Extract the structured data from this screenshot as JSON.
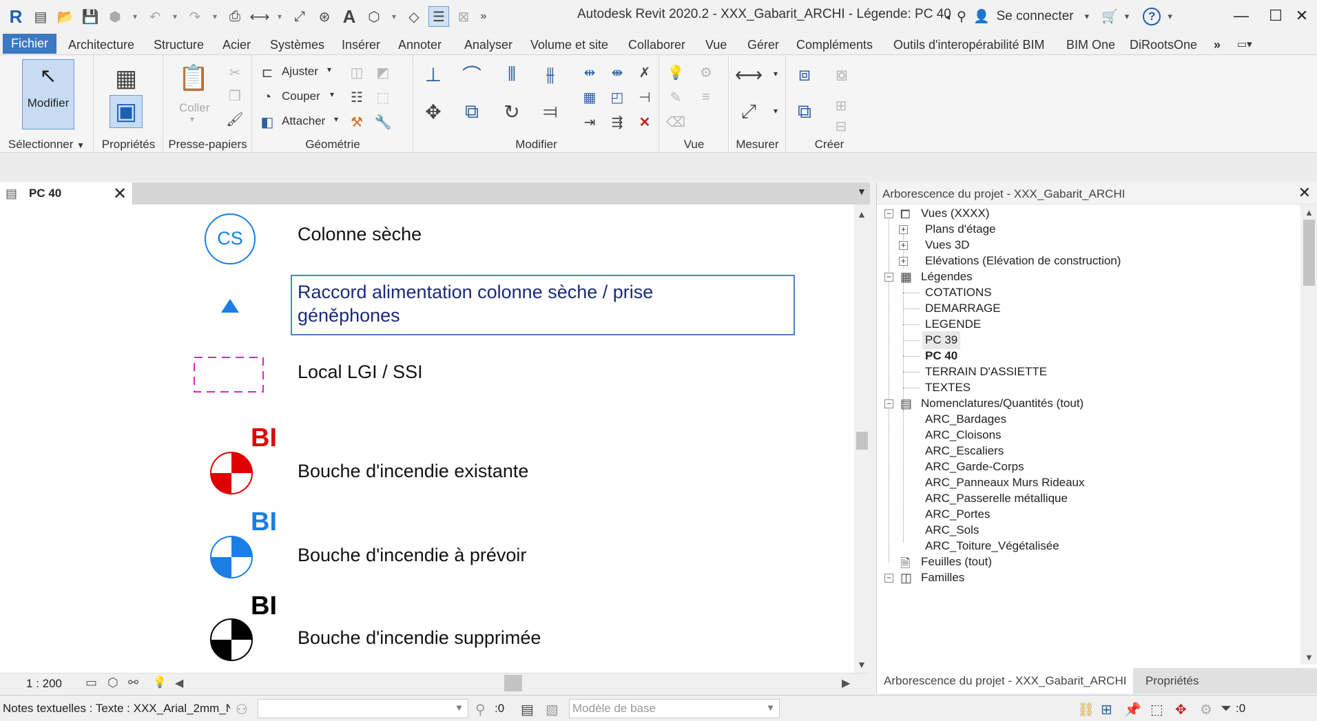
{
  "titlebar": {
    "title": "Autodesk Revit 2020.2 - XXX_Gabarit_ARCHI - Légende: PC 40",
    "sign_in": "Se connecter",
    "help": "?"
  },
  "menu": {
    "tabs": [
      "Fichier",
      "Architecture",
      "Structure",
      "Acier",
      "Systèmes",
      "Insérer",
      "Annoter",
      "Analyser",
      "Volume et site",
      "Collaborer",
      "Vue",
      "Gérer",
      "Compléments",
      "Outils d'interopérabilité BIM",
      "BIM One",
      "DiRootsOne"
    ]
  },
  "ribbon": {
    "modify_label": "Modifier",
    "select_label": "Sélectionner",
    "properties_label": "Propriétés",
    "paste_label": "Coller",
    "clipboard_label": "Presse-papiers",
    "geometry_label": "Géométrie",
    "trim_label": "Ajuster",
    "cut_label": "Couper",
    "join_label": "Attacher",
    "modify_panel_label": "Modifier",
    "view_label": "Vue",
    "measure_label": "Mesurer",
    "create_label": "Créer"
  },
  "view": {
    "tab_name": "PC 40",
    "legend": {
      "cs_symbol": "CS",
      "item1": "Colonne sèche",
      "item2_line1": "Raccord alimentation colonne sèche / prise",
      "item2_line2": "géněphones",
      "item3": "Local LGI / SSI",
      "bi_label": "BI",
      "item4": "Bouche d'incendie existante",
      "item5": "Bouche d'incendie à prévoir",
      "item6": "Bouche d'incendie supprimée"
    },
    "scale": "1 : 200"
  },
  "browser": {
    "title": "Arborescence du projet - XXX_Gabarit_ARCHI",
    "tree": {
      "views": "Vues (XXXX)",
      "floor_plans": "Plans d'étage",
      "views_3d": "Vues 3D",
      "elevations": "Elévations (Elévation de construction)",
      "legends": "Légendes",
      "legend_items": [
        "COTATIONS",
        "DEMARRAGE",
        "LEGENDE",
        "PC 39",
        "PC 40",
        "TERRAIN D'ASSIETTE",
        "TEXTES"
      ],
      "schedules": "Nomenclatures/Quantités (tout)",
      "schedule_items": [
        "ARC_Bardages",
        "ARC_Cloisons",
        "ARC_Escaliers",
        "ARC_Garde-Corps",
        "ARC_Panneaux Murs Rideaux",
        "ARC_Passerelle métallique",
        "ARC_Portes",
        "ARC_Sols",
        "ARC_Toiture_Végétalisée"
      ],
      "sheets": "Feuilles (tout)",
      "families": "Familles"
    },
    "tabs": [
      "Arborescence du projet - XXX_Gabarit_ARCHI",
      "Propriétés"
    ]
  },
  "status": {
    "text": "Notes textuelles : Texte : XXX_Arial_2mm_N",
    "count": ":0",
    "model": "Modèle de base",
    "filter_count": ":0"
  },
  "colors": {
    "accent": "#3b79c1",
    "legend_blue": "#1a7ee6",
    "legend_red": "#e00000",
    "legend_magenta": "#e020c8"
  }
}
